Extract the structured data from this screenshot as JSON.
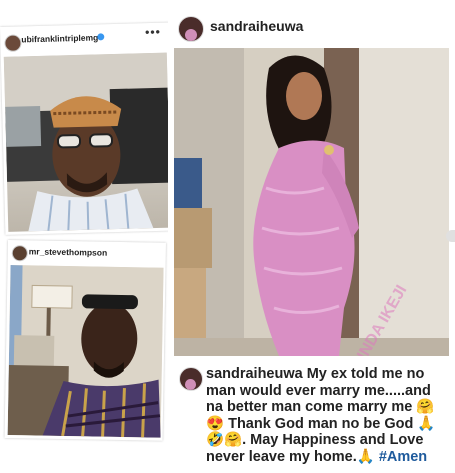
{
  "left_top_post": {
    "username": "ubifranklintriplemg",
    "verified_badge": "verified-badge-icon",
    "menu_icon": "more-options-icon",
    "photo": "man-with-glasses-in-car"
  },
  "left_bottom_post": {
    "username": "mr_stevethompson",
    "photo": "man-with-sunglasses-on-head"
  },
  "right_post": {
    "username": "sandraiheuwa",
    "photo": "woman-in-pink-lace-dress",
    "caption_username": "sandraiheuwa",
    "caption_text": " My ex told me no man would ever marry me.....and na better man come marry me 🤗😍 Thank God man no be God 🙏🤣🤗. May Happiness and Love never leave my home.🙏 ",
    "hashtag": "#Amen",
    "watermark": "LINDA IKEJI"
  },
  "colors": {
    "dress_pink": "#d98fc4",
    "link_blue": "#1e5a9c"
  }
}
